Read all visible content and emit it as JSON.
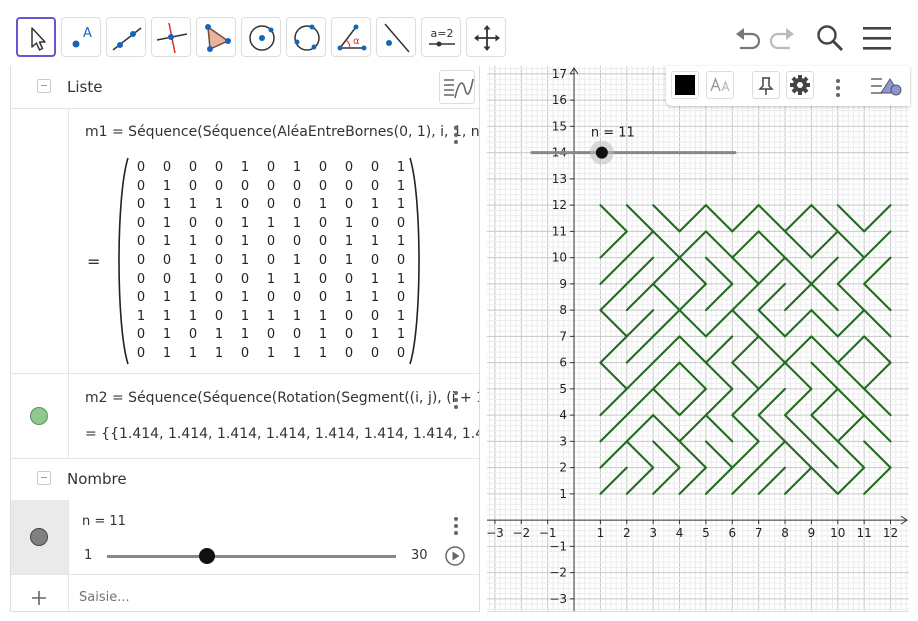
{
  "toolbar": {
    "tools": [
      {
        "id": "move",
        "icon": "arrow-pointer-icon"
      },
      {
        "id": "point",
        "icon": "point-icon",
        "label": "A"
      },
      {
        "id": "line",
        "icon": "line-icon"
      },
      {
        "id": "perpendicular",
        "icon": "perpendicular-line-icon"
      },
      {
        "id": "polygon",
        "icon": "polygon-icon"
      },
      {
        "id": "circle",
        "icon": "circle-center-point-icon"
      },
      {
        "id": "circle3",
        "icon": "circle-three-points-icon"
      },
      {
        "id": "angle",
        "icon": "angle-icon",
        "label": "α"
      },
      {
        "id": "reflect",
        "icon": "reflect-line-icon"
      },
      {
        "id": "slider",
        "icon": "slider-icon",
        "label": "a=2"
      },
      {
        "id": "move-graphics",
        "icon": "move-graphics-icon"
      }
    ],
    "right": [
      "undo-icon",
      "redo-icon",
      "search-icon",
      "menu-icon"
    ]
  },
  "algebra": {
    "liste_header": "Liste",
    "nombre_header": "Nombre",
    "m1": {
      "definition": "m1 = Séquence(Séquence(AléaEntreBornes(0, 1), i, 1, n",
      "equals": "=",
      "matrix": [
        [
          0,
          0,
          0,
          0,
          1,
          0,
          1,
          0,
          0,
          0,
          1
        ],
        [
          0,
          1,
          0,
          0,
          0,
          0,
          0,
          0,
          0,
          0,
          1
        ],
        [
          0,
          1,
          1,
          1,
          0,
          0,
          0,
          1,
          0,
          1,
          1
        ],
        [
          0,
          1,
          0,
          0,
          1,
          1,
          1,
          0,
          1,
          0,
          0
        ],
        [
          0,
          1,
          1,
          0,
          1,
          0,
          0,
          0,
          1,
          1,
          1
        ],
        [
          0,
          0,
          1,
          0,
          1,
          0,
          1,
          0,
          1,
          0,
          0
        ],
        [
          0,
          0,
          1,
          0,
          0,
          1,
          1,
          0,
          0,
          1,
          1
        ],
        [
          0,
          1,
          1,
          0,
          1,
          0,
          0,
          0,
          1,
          1,
          0
        ],
        [
          1,
          1,
          1,
          0,
          1,
          1,
          1,
          1,
          0,
          0,
          1
        ],
        [
          0,
          1,
          0,
          1,
          1,
          0,
          0,
          1,
          0,
          1,
          1
        ],
        [
          0,
          1,
          1,
          1,
          0,
          1,
          1,
          1,
          0,
          0,
          0
        ]
      ]
    },
    "m2": {
      "definition": "m2 = Séquence(Séquence(Rotation(Segment((i, j), (i + 1, j)), (",
      "value": "= {{1.414, 1.414, 1.414, 1.414, 1.414, 1.414, 1.414, 1.414, 1.414",
      "color": "#90c890"
    },
    "n": {
      "definition": "n = 11",
      "min": "1",
      "max": "30",
      "value": 11,
      "range": [
        1,
        30
      ]
    },
    "input_placeholder": "Saisie..."
  },
  "graphics": {
    "slider_label": "n = 11",
    "x_ticks": [
      "−3",
      "−2",
      "−1",
      "1",
      "2",
      "3",
      "4",
      "5",
      "6",
      "7",
      "8",
      "9",
      "10",
      "11",
      "12"
    ],
    "y_ticks": [
      "17",
      "16",
      "15",
      "14",
      "13",
      "12",
      "11",
      "10",
      "9",
      "8",
      "7",
      "6",
      "5",
      "4",
      "3",
      "2",
      "1",
      "−1",
      "−2",
      "−3"
    ],
    "maze_color": "#1e6b1e",
    "x_range": [
      -3.3,
      12.7
    ],
    "y_range": [
      -3.5,
      17.3
    ]
  }
}
